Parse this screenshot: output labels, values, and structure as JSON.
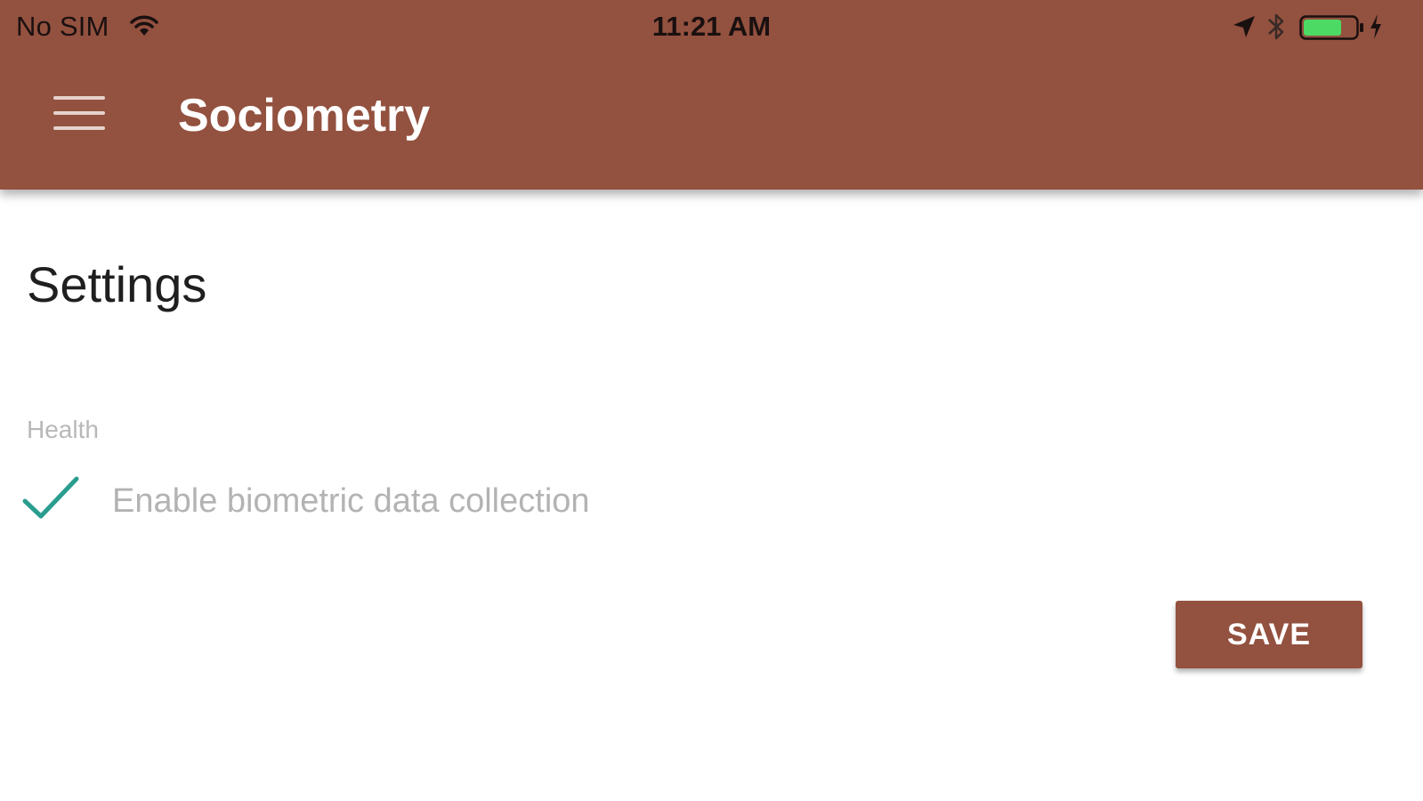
{
  "status_bar": {
    "carrier": "No SIM",
    "time": "11:21 AM",
    "icons": [
      "wifi-icon",
      "location-arrow-icon",
      "bluetooth-icon",
      "battery-icon",
      "charging-bolt-icon"
    ]
  },
  "header": {
    "title": "Sociometry",
    "menu_icon": "hamburger-menu-icon"
  },
  "main": {
    "heading": "Settings",
    "sections": [
      {
        "label": "Health",
        "options": [
          {
            "label": "Enable biometric data collection",
            "checked": true
          }
        ]
      }
    ],
    "save_label": "SAVE"
  },
  "colors": {
    "primary": "#93513f",
    "accent_check": "#2a9d8f",
    "label_muted": "#b3b3b3",
    "battery_fill": "#4cd964"
  }
}
